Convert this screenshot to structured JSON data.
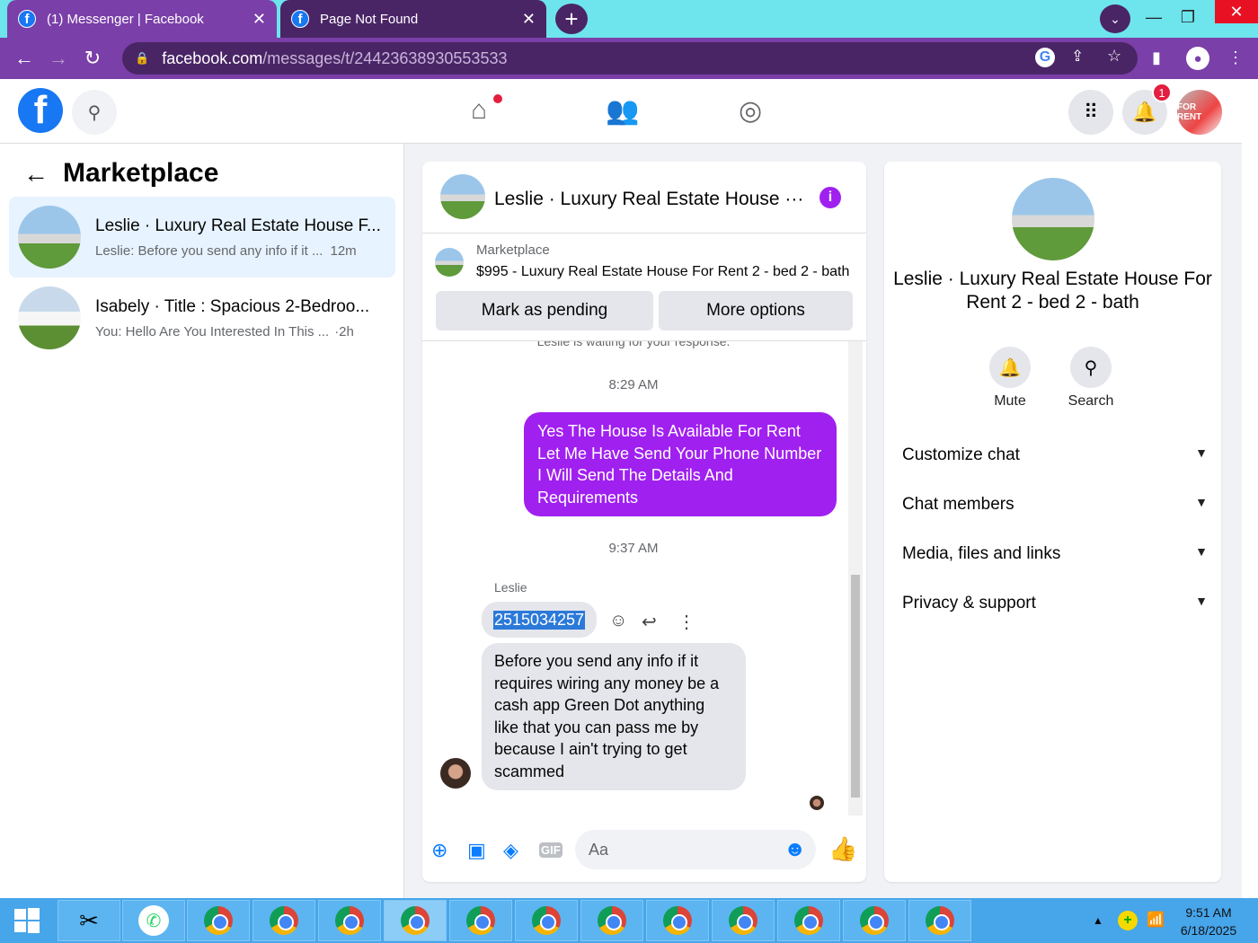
{
  "browser": {
    "tabs": [
      {
        "title": "(1) Messenger | Facebook"
      },
      {
        "title": "Page Not Found"
      }
    ],
    "url_host": "facebook.com",
    "url_path": "/messages/t/24423638930553533"
  },
  "header": {
    "notification_count": "1",
    "avatar_text": "FOR RENT"
  },
  "left_panel": {
    "title": "Marketplace",
    "conversations": [
      {
        "name": "Leslie · Luxury Real Estate House F...",
        "preview": "Leslie: Before you send any info if it ...",
        "time": "12m"
      },
      {
        "name": "Isabely · Title : Spacious 2-Bedroo...",
        "preview": "You: Hello Are You Interested In This ...",
        "time": "·2h"
      }
    ]
  },
  "chat": {
    "header_name": "Leslie · Luxury Real Estate House ···",
    "listing_label": "Marketplace",
    "listing_title": "$995 - Luxury Real Estate House For Rent 2 - bed 2 - bath",
    "mark_pending_label": "Mark as pending",
    "more_options_label": "More options",
    "waiting_text": "Leslie is waiting for your response.",
    "time1": "8:29 AM",
    "outgoing_message": "Yes The House Is Available For Rent Let Me Have Send Your Phone Number I Will Send The Details And Requirements",
    "time2": "9:37 AM",
    "sender_name": "Leslie",
    "phone_message": "2515034257",
    "incoming_message": "Before you send any info if it requires wiring any money be a cash app Green Dot anything like that you can pass me by because I ain't trying to get scammed",
    "composer_placeholder": "Aa"
  },
  "info_panel": {
    "name": "Leslie · Luxury Real Estate House For Rent 2 - bed 2 - bath",
    "mute_label": "Mute",
    "search_label": "Search",
    "sections": [
      "Customize chat",
      "Chat members",
      "Media, files and links",
      "Privacy & support"
    ]
  },
  "taskbar": {
    "time": "9:51 AM",
    "date": "6/18/2025"
  },
  "colors": {
    "accent": "#a020f0",
    "fb_blue": "#1877f2",
    "chrome_frame": "#7a3fa8"
  }
}
